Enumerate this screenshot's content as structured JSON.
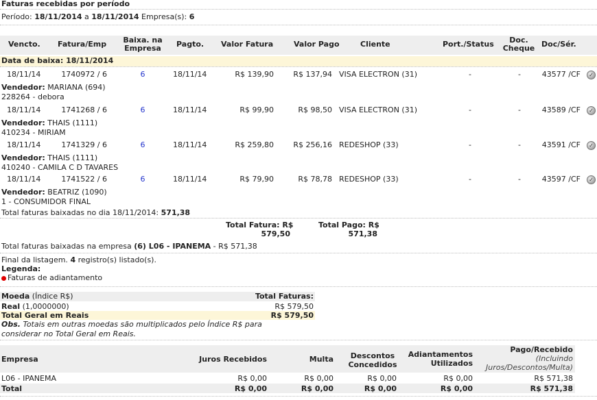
{
  "title": "Faturas recebidas por período",
  "period": {
    "label": "Período:",
    "from": "18/11/2014",
    "sep": "a",
    "to": "18/11/2014",
    "company_label": "Empresa(s):",
    "company": "6"
  },
  "columns": {
    "vencto": "Vencto.",
    "fatura": "Fatura/Emp",
    "baixa": [
      "Baixa. na",
      "Empresa"
    ],
    "pagto": "Pagto.",
    "valor_fatura": "Valor Fatura",
    "valor_pago": "Valor Pago",
    "cliente": "Cliente",
    "port": "Port./Status",
    "doc": [
      "Doc.",
      "Cheque"
    ],
    "docser": "Doc/Sér."
  },
  "group": {
    "label": "Data de baixa:",
    "date": "18/11/2014"
  },
  "rows": [
    {
      "vencto": "18/11/14",
      "fatura": "1740972 / 6",
      "baixa": "6",
      "pagto": "18/11/14",
      "valor_fatura": "R$ 139,90",
      "valor_pago": "R$ 137,94",
      "cliente": "VISA ELECTRON (31)",
      "port": "-",
      "doc": "-",
      "docser": "43577 /CF",
      "vend_label": "Vendedor:",
      "vendedor": "MARIANA (694)",
      "cliente_desc": "228264 - debora"
    },
    {
      "vencto": "18/11/14",
      "fatura": "1741268 / 6",
      "baixa": "6",
      "pagto": "18/11/14",
      "valor_fatura": "R$ 99,90",
      "valor_pago": "R$ 98,50",
      "cliente": "VISA ELECTRON (31)",
      "port": "-",
      "doc": "-",
      "docser": "43589 /CF",
      "vend_label": "Vendedor:",
      "vendedor": "THAIS (1111)",
      "cliente_desc": "410234 - MIRIAM"
    },
    {
      "vencto": "18/11/14",
      "fatura": "1741329 / 6",
      "baixa": "6",
      "pagto": "18/11/14",
      "valor_fatura": "R$ 259,80",
      "valor_pago": "R$ 256,16",
      "cliente": "REDESHOP (33)",
      "port": "-",
      "doc": "-",
      "docser": "43591 /CF",
      "vend_label": "Vendedor:",
      "vendedor": "THAIS (1111)",
      "cliente_desc": "410240 - CAMILA C D TAVARES"
    },
    {
      "vencto": "18/11/14",
      "fatura": "1741522 / 6",
      "baixa": "6",
      "pagto": "18/11/14",
      "valor_fatura": "R$ 79,90",
      "valor_pago": "R$ 78,78",
      "cliente": "REDESHOP (33)",
      "port": "-",
      "doc": "-",
      "docser": "43597 /CF",
      "vend_label": "Vendedor:",
      "vendedor": "BEATRIZ (1090)",
      "cliente_desc": "1 - CONSUMIDOR FINAL"
    }
  ],
  "day_total": {
    "label": "Total faturas baixadas no dia 18/11/2014:",
    "value": "571,38"
  },
  "totals": {
    "fatura_label": "Total Fatura: R$",
    "fatura_value": "579,50",
    "pago_label": "Total Pago: R$",
    "pago_value": "571,38"
  },
  "company_total": {
    "label": "Total faturas baixadas na empresa",
    "company": "(6) L06 - IPANEMA",
    "value": "- R$ 571,38"
  },
  "end": {
    "prefix": "Final da listagem.",
    "count": "4",
    "suffix": "registro(s) listado(s)."
  },
  "legend": {
    "title": "Legenda:",
    "item": "Faturas de adiantamento",
    "dot_color": "#e00000"
  },
  "currency": {
    "col_moeda": "Moeda",
    "col_indice": "(Índice R$)",
    "col_total": "Total Faturas:",
    "real_label": "Real",
    "real_index": "(1,0000000)",
    "real_value": "R$ 579,50",
    "total_label": "Total Geral em Reais",
    "total_value": "R$ 579,50",
    "obs_label": "Obs.",
    "obs_text1": "Totais em outras moedas são multiplicados pelo Índice R$ para",
    "obs_text2": "considerar no Total Geral em Reais."
  },
  "summary": {
    "headers": {
      "empresa": "Empresa",
      "juros": "Juros Recebidos",
      "multa": "Multa",
      "descontos": [
        "Descontos",
        "Concedidos"
      ],
      "adiant": [
        "Adiantamentos",
        "Utilizados"
      ],
      "pago": "Pago/Recebido",
      "pago_note": [
        "(Incluindo",
        "Juros/Descontos/Multa)"
      ]
    },
    "row": {
      "empresa": "L06 - IPANEMA",
      "juros": "R$ 0,00",
      "multa": "R$ 0,00",
      "descontos": "R$ 0,00",
      "adiant": "R$ 0,00",
      "pago": "R$ 571,38"
    },
    "total": {
      "label": "Total",
      "juros": "R$ 0,00",
      "multa": "R$ 0,00",
      "descontos": "R$ 0,00",
      "adiant": "R$ 0,00",
      "pago": "R$ 571,38"
    }
  }
}
